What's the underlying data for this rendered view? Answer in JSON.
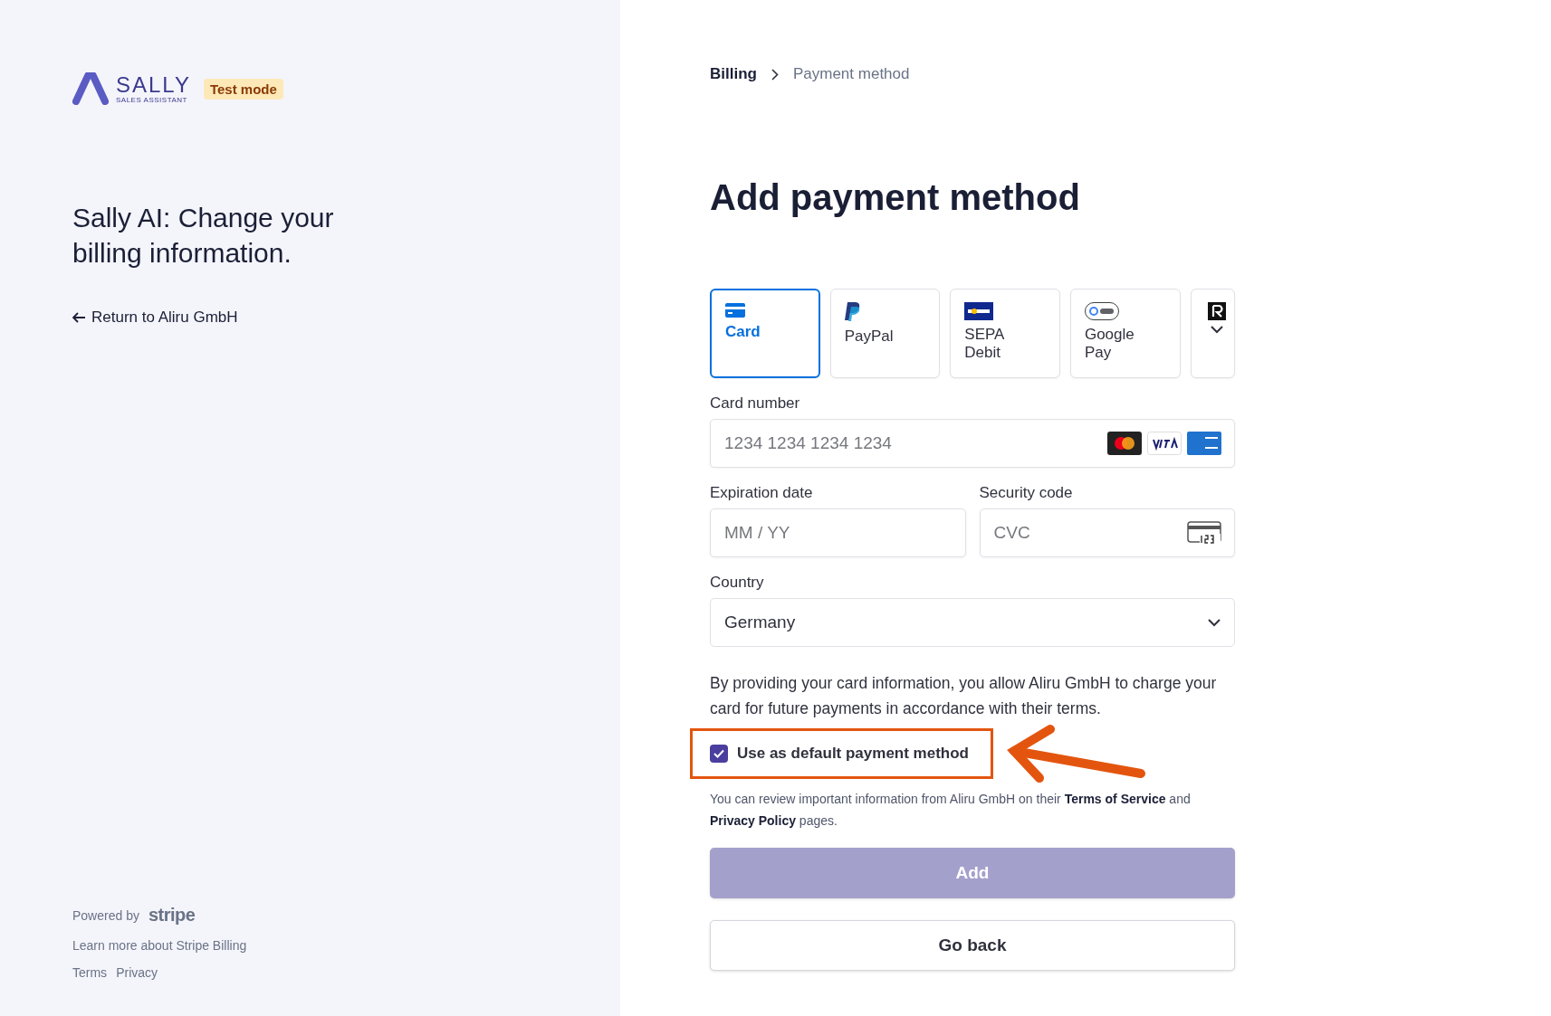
{
  "brand": {
    "name": "SALLY",
    "tagline": "SALES ASSISTANT",
    "badge": "Test mode"
  },
  "left": {
    "heading": "Sally AI: Change your billing information.",
    "back_link": "Return to Aliru GmbH"
  },
  "footer": {
    "powered_by": "Powered by",
    "powered_brand": "stripe",
    "learn_more": "Learn more about Stripe Billing",
    "links": [
      "Terms",
      "Privacy"
    ]
  },
  "breadcrumb": [
    {
      "label": "Billing"
    },
    {
      "label": "Payment method"
    }
  ],
  "title": "Add payment method",
  "tabs": [
    {
      "kind": "card",
      "label": "Card",
      "selected": true
    },
    {
      "kind": "paypal",
      "label": "PayPal",
      "selected": false
    },
    {
      "kind": "sepa",
      "label": "SEPA Debit",
      "selected": false
    },
    {
      "kind": "gpay",
      "label": "Google Pay",
      "selected": false
    },
    {
      "kind": "more",
      "selected": false
    }
  ],
  "card_number": {
    "label": "Card number",
    "placeholder": "1234 1234 1234 1234"
  },
  "expiration": {
    "label": "Expiration date",
    "placeholder": "MM / YY"
  },
  "security": {
    "label": "Security code",
    "placeholder": "CVC"
  },
  "country": {
    "label": "Country",
    "value": "Germany"
  },
  "consent": "By providing your card information, you allow Aliru GmbH to charge your card for future payments in accordance with their terms.",
  "default_checkbox": {
    "label": "Use as default payment method",
    "checked": true
  },
  "legal": "You can review important information from Aliru GmbH on their **Terms of Service** and **Privacy Policy** pages.",
  "buttons": [
    {
      "label": "Add",
      "kind": "primary"
    },
    {
      "label": "Go back",
      "kind": "secondary"
    }
  ]
}
